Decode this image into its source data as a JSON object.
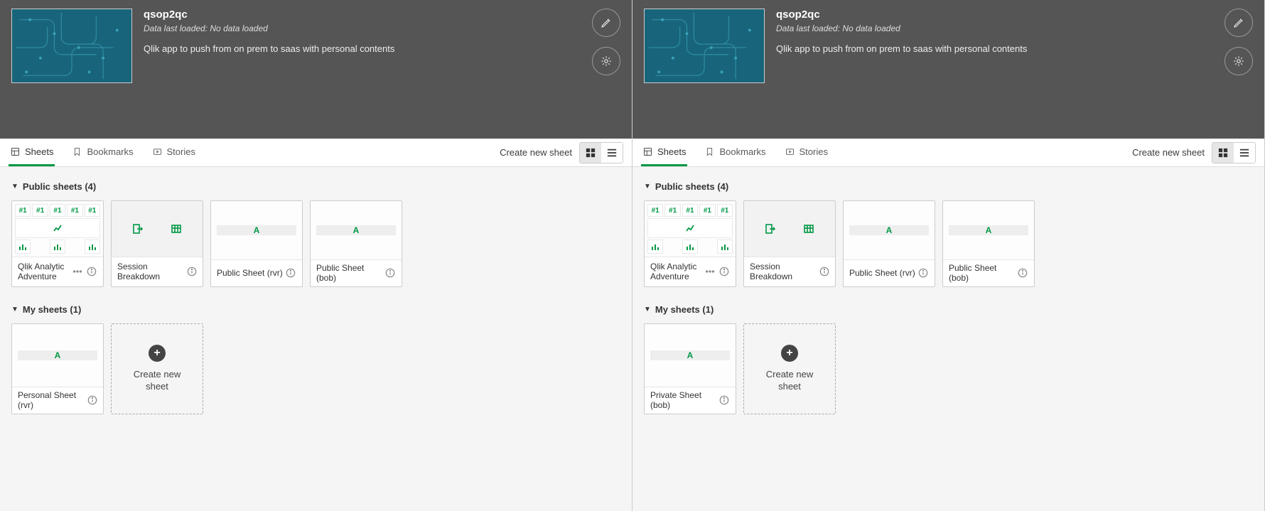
{
  "panels": [
    {
      "app": {
        "title": "qsop2qc",
        "loaded": "Data last loaded: No data loaded",
        "description": "Qlik app to push from on prem to saas with personal contents"
      },
      "tabs": {
        "sheets": "Sheets",
        "bookmarks": "Bookmarks",
        "stories": "Stories"
      },
      "create_link": "Create new sheet",
      "sections": {
        "public_label": "Public sheets (4)",
        "public": [
          {
            "label": "Qlik Analytic Adventure",
            "type": "kpi",
            "has_more": true
          },
          {
            "label": "Session Breakdown",
            "type": "session"
          },
          {
            "label": "Public Sheet (rvr)",
            "type": "a"
          },
          {
            "label": "Public Sheet (bob)",
            "type": "a"
          }
        ],
        "my_label": "My sheets (1)",
        "my": [
          {
            "label": "Personal Sheet (rvr)",
            "type": "a"
          }
        ],
        "create_card": "Create new sheet"
      }
    },
    {
      "app": {
        "title": "qsop2qc",
        "loaded": "Data last loaded: No data loaded",
        "description": "Qlik app to push from on prem to saas with personal contents"
      },
      "tabs": {
        "sheets": "Sheets",
        "bookmarks": "Bookmarks",
        "stories": "Stories"
      },
      "create_link": "Create new sheet",
      "sections": {
        "public_label": "Public sheets (4)",
        "public": [
          {
            "label": "Qlik Analytic Adventure",
            "type": "kpi",
            "has_more": true
          },
          {
            "label": "Session Breakdown",
            "type": "session"
          },
          {
            "label": "Public Sheet (rvr)",
            "type": "a"
          },
          {
            "label": "Public Sheet (bob)",
            "type": "a"
          }
        ],
        "my_label": "My sheets (1)",
        "my": [
          {
            "label": "Private Sheet (bob)",
            "type": "a"
          }
        ],
        "create_card": "Create new sheet"
      }
    }
  ],
  "kpi_tag": "#1",
  "a_glyph": "A"
}
